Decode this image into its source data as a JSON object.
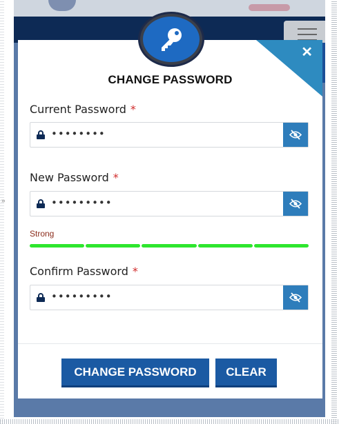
{
  "modal": {
    "title": "CHANGE PASSWORD",
    "close_icon": "close-icon",
    "badge_icon": "key-icon"
  },
  "fields": {
    "current": {
      "label": "Current Password",
      "required": "*",
      "value": "••••••••"
    },
    "new": {
      "label": "New Password",
      "required": "*",
      "value": "•••••••••"
    },
    "confirm": {
      "label": "Confirm Password",
      "required": "*",
      "value": "•••••••••"
    }
  },
  "strength": {
    "label": "Strong",
    "level": 1.0,
    "segments": 5,
    "color": "#2ee62e"
  },
  "buttons": {
    "change_label": "CHANGE PASSWORD",
    "clear_label": "CLEAR"
  },
  "colors": {
    "primary_button": "#1b5aa3",
    "eye_toggle": "#2e7dbb",
    "required": "#d12c2c",
    "header": "#0d2a55",
    "corner": "#2e8bc0"
  }
}
